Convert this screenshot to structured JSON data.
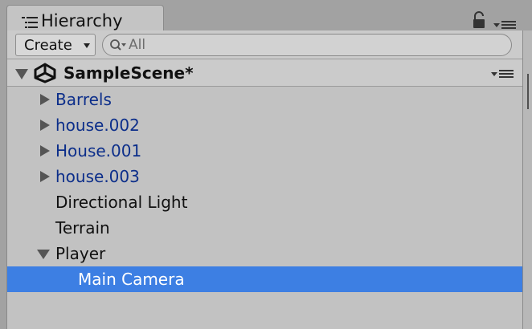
{
  "tab": {
    "title": "Hierarchy",
    "icon": "list-icon"
  },
  "window_icons": {
    "lock": "lock-icon",
    "menu": "menu-icon"
  },
  "toolbar": {
    "create_label": "Create",
    "create_icon": "chevron-down-icon",
    "search_placeholder": "All",
    "search_value": "",
    "search_icon": "search-icon"
  },
  "scene": {
    "name": "SampleScene*",
    "icon": "unity-icon",
    "expanded": true
  },
  "items": [
    {
      "label": "Barrels",
      "kind": "prefab",
      "expandable": true,
      "expanded": false,
      "depth": 1
    },
    {
      "label": "house.002",
      "kind": "prefab",
      "expandable": true,
      "expanded": false,
      "depth": 1
    },
    {
      "label": "House.001",
      "kind": "prefab",
      "expandable": true,
      "expanded": false,
      "depth": 1
    },
    {
      "label": "house.003",
      "kind": "prefab",
      "expandable": true,
      "expanded": false,
      "depth": 1
    },
    {
      "label": "Directional Light",
      "kind": "object",
      "expandable": false,
      "depth": 1
    },
    {
      "label": "Terrain",
      "kind": "object",
      "expandable": false,
      "depth": 1
    },
    {
      "label": "Player",
      "kind": "object",
      "expandable": true,
      "expanded": true,
      "depth": 1
    },
    {
      "label": "Main Camera",
      "kind": "object",
      "expandable": false,
      "depth": 2,
      "selected": true
    }
  ],
  "colors": {
    "background": "#c2c2c2",
    "prefab_text": "#0c2e8a",
    "selection": "#3d7fe3",
    "selected_text": "#ffffff"
  }
}
